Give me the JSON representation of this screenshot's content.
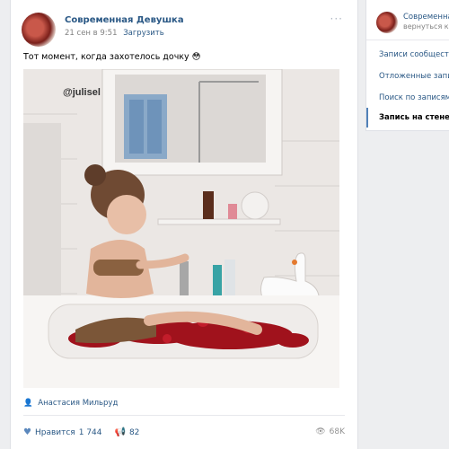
{
  "post": {
    "author": "Современная Девушка",
    "date": "21 сен в 9:51",
    "upload_label": "Загрузить",
    "text": "Тот момент, когда захотелось дочку 😳",
    "watermark": "@julisel",
    "photo_credit": "Анастасия Мильруд",
    "likes_label": "Нравится",
    "likes_count": "1 744",
    "shares_count": "82",
    "views_count": "68K",
    "more_label": "···"
  },
  "sidebar": {
    "group_name": "Современная Девушка",
    "back_label": "вернуться к сообществу",
    "items": [
      {
        "label": "Записи сообщества"
      },
      {
        "label": "Отложенные записи"
      },
      {
        "label": "Поиск по записям"
      },
      {
        "label": "Запись на стене"
      }
    ]
  },
  "icons": {
    "like": "heart-icon",
    "share": "megaphone-icon",
    "views": "eye-icon",
    "credit": "person-icon",
    "more": "more-dots-icon"
  },
  "colors": {
    "link": "#2a5885",
    "accent": "#5181b8",
    "background": "#edeef0"
  }
}
